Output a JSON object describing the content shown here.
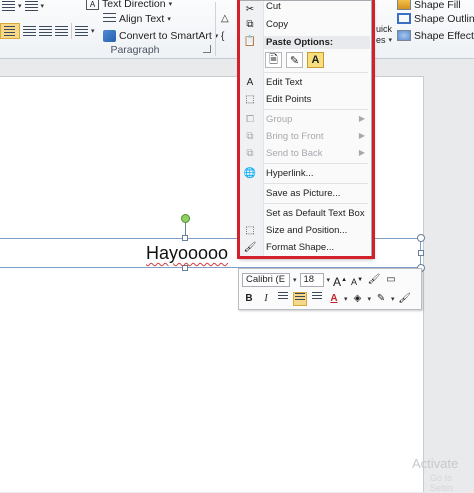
{
  "ribbon": {
    "text_direction_label": "Text Direction",
    "align_text_label": "Align Text",
    "convert_smartart_label": "Convert to SmartArt",
    "paragraph_group_label": "Paragraph",
    "quick_styles_fragment_1": "uick",
    "quick_styles_fragment_2": "es",
    "shape_fill_label": "Shape Fill",
    "shape_outline_label": "Shape Outline",
    "shape_effects_label": "Shape Effects"
  },
  "context_menu": {
    "cut": "Cut",
    "copy": "Copy",
    "paste_options_header": "Paste Options:",
    "paste_option_keep_text": "A",
    "edit_text": "Edit Text",
    "edit_points": "Edit Points",
    "group": "Group",
    "bring_to_front": "Bring to Front",
    "send_to_back": "Send to Back",
    "hyperlink": "Hyperlink...",
    "save_as_picture": "Save as Picture...",
    "set_default_text_box": "Set as Default Text Box",
    "size_and_position": "Size and Position...",
    "format_shape": "Format Shape..."
  },
  "mini_toolbar": {
    "font_name": "Calibri (E",
    "font_size": "18",
    "grow_font": "A",
    "shrink_font": "A",
    "bold": "B",
    "italic": "I",
    "font_color": "A"
  },
  "document": {
    "textbox_text": "Hayooooo",
    "watermark_main": "Activate",
    "watermark_sub": "Go to Settin"
  },
  "colors": {
    "highlight_border": "#d3212b",
    "selected_button": "#f6d88a",
    "rotation_handle": "#8fd160"
  }
}
